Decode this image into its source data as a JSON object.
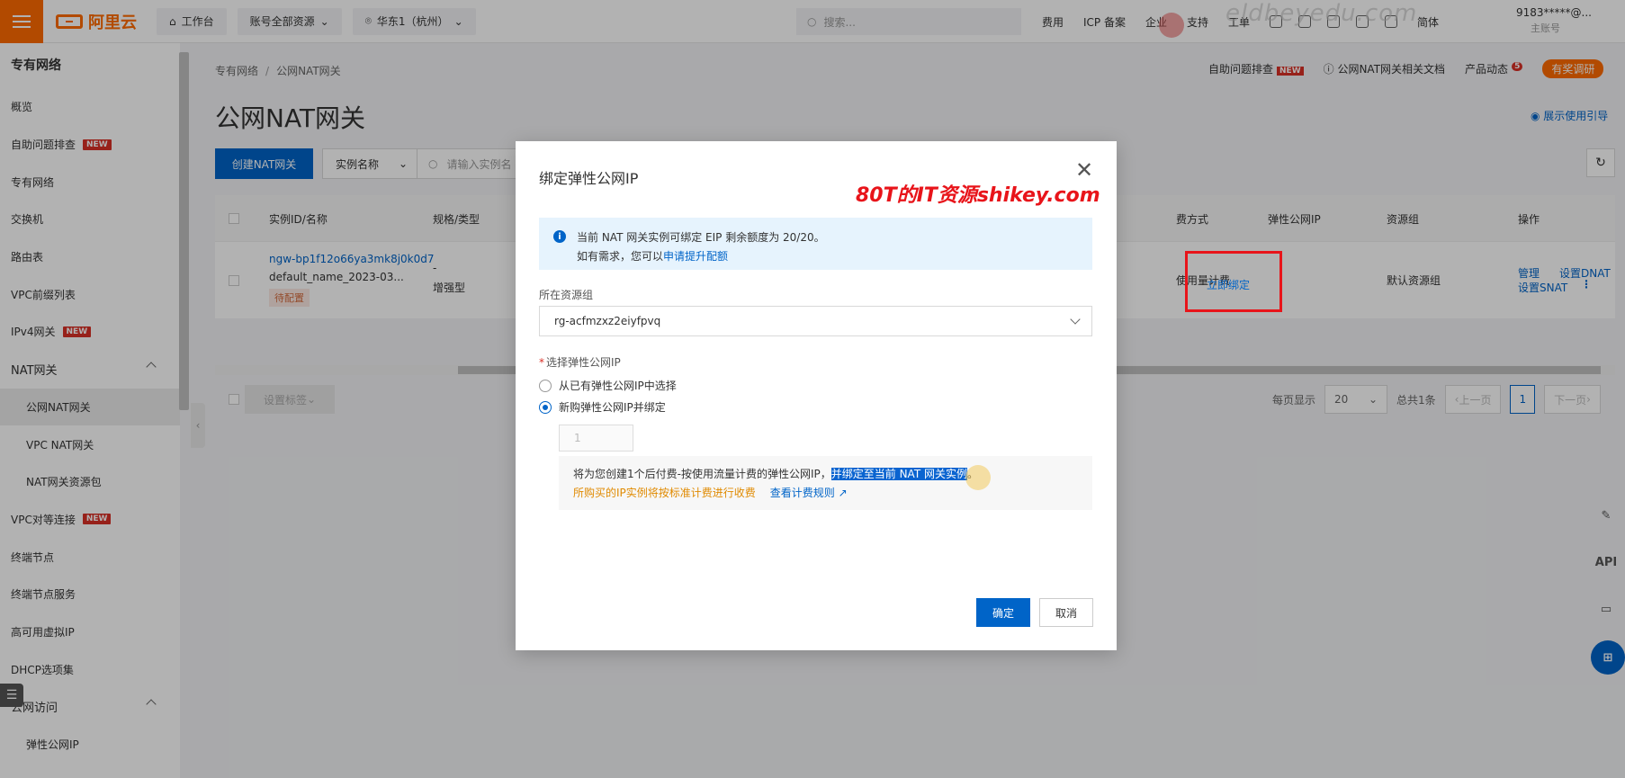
{
  "topbar": {
    "logo_text": "阿里云",
    "workbench": "工作台",
    "account_resources": "账号全部资源",
    "region": "华东1（杭州）",
    "search_placeholder": "搜索...",
    "links": [
      "费用",
      "ICP 备案",
      "企业",
      "支持",
      "工单"
    ],
    "lang": "简体",
    "user_name": "9183*****@...",
    "user_role": "主账号",
    "watermark": "eldbeyedu.com"
  },
  "sidebar": {
    "title": "专有网络",
    "items": [
      {
        "label": "概览"
      },
      {
        "label": "自助问题排查",
        "badge": "NEW"
      },
      {
        "label": "专有网络"
      },
      {
        "label": "交换机"
      },
      {
        "label": "路由表"
      },
      {
        "label": "VPC前缀列表"
      },
      {
        "label": "IPv4网关",
        "badge": "NEW"
      },
      {
        "label": "NAT网关"
      },
      {
        "label": "公网NAT网关"
      },
      {
        "label": "VPC NAT网关"
      },
      {
        "label": "NAT网关资源包"
      },
      {
        "label": "VPC对等连接",
        "badge": "NEW"
      },
      {
        "label": "终端节点"
      },
      {
        "label": "终端节点服务"
      },
      {
        "label": "高可用虚拟IP"
      },
      {
        "label": "DHCP选项集"
      },
      {
        "label": "公网访问"
      },
      {
        "label": "弹性公网IP"
      }
    ]
  },
  "main": {
    "breadcrumb": [
      "专有网络",
      "公网NAT网关"
    ],
    "top_links": {
      "self_check": "自助问题排查",
      "self_check_badge": "NEW",
      "docs": "公网NAT网关相关文档",
      "product_news": "产品动态",
      "news_count": "5",
      "survey": "有奖调研"
    },
    "title": "公网NAT网关",
    "guide": "展示使用引导",
    "create_button": "创建NAT网关",
    "filter_field": "实例名称",
    "filter_placeholder": "请输入实例名",
    "table": {
      "headers": [
        "实例ID/名称",
        "规格/类型",
        "费方式",
        "弹性公网IP",
        "资源组",
        "操作"
      ],
      "row": {
        "id": "ngw-bp1f12o66ya3mk8j0k0d7",
        "name": "default_name_2023-03...",
        "status": "待配置",
        "spec": "-",
        "type": "增强型",
        "billing": "使用量计费",
        "eip_action": "立即绑定",
        "resource_group": "默认资源组",
        "ops": [
          "管理",
          "设置DNAT",
          "设置SNAT"
        ]
      }
    },
    "tag_button": "设置标签",
    "pager": {
      "per_page_label": "每页显示",
      "per_page": "20",
      "total": "总共1条",
      "prev": "上一页",
      "current": "1",
      "next": "下一页"
    },
    "float_icons": [
      "API"
    ]
  },
  "dialog": {
    "title": "绑定弹性公网IP",
    "watermark": "80T的IT资源shikey.com",
    "info_line1": "当前 NAT 网关实例可绑定 EIP 剩余额度为 20/20。",
    "info_line2_prefix": "如有需求，您可以",
    "info_line2_link": "申请提升配额",
    "rg_label": "所在资源组",
    "rg_value": "rg-acfmzxz2eiyfpvq",
    "eip_label": "选择弹性公网IP",
    "option_existing": "从已有弹性公网IP中选择",
    "option_new": "新购弹性公网IP并绑定",
    "quantity": "1",
    "notice_text": "将为您创建1个后付费-按使用流量计费的弹性公网IP，",
    "notice_highlight": "并绑定至当前 NAT 网关实例",
    "notice_end": "。",
    "notice_warning": "所购买的IP实例将按标准计费进行收费",
    "notice_link": "查看计费规则",
    "ok": "确定",
    "cancel": "取消"
  }
}
